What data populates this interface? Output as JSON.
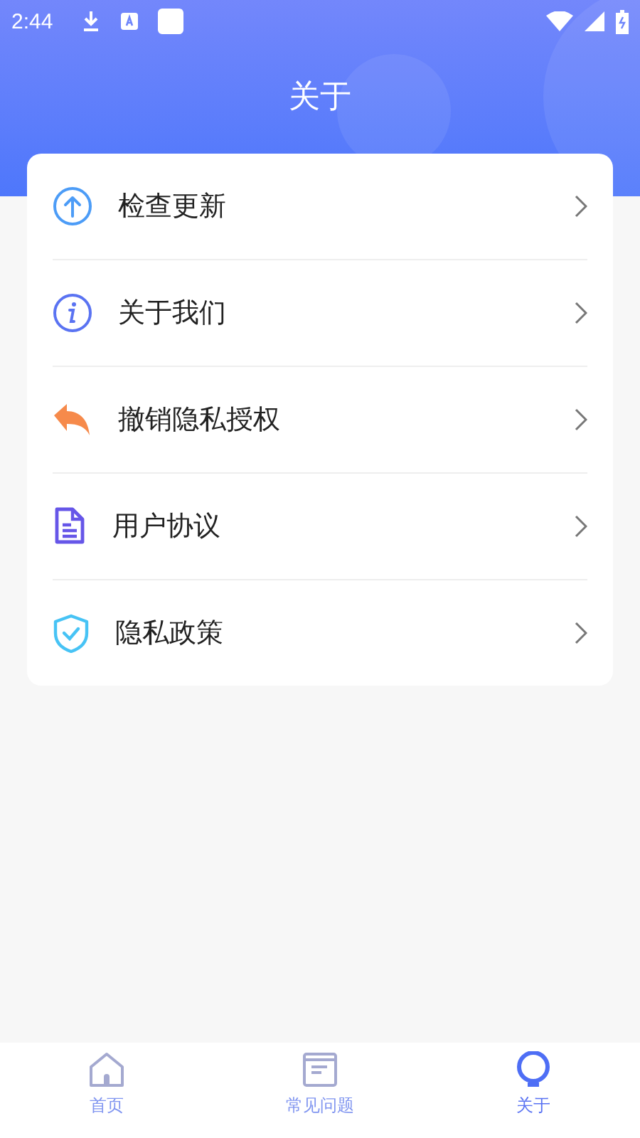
{
  "status_bar": {
    "time": "2:44"
  },
  "header": {
    "title": "关于"
  },
  "menu": [
    {
      "kind": "update",
      "label": "检查更新"
    },
    {
      "kind": "info",
      "label": "关于我们"
    },
    {
      "kind": "revoke",
      "label": "撤销隐私授权"
    },
    {
      "kind": "agreement",
      "label": "用户协议"
    },
    {
      "kind": "privacy",
      "label": "隐私政策"
    }
  ],
  "tabs": [
    {
      "kind": "home",
      "label": "首页",
      "selected": false
    },
    {
      "kind": "faq",
      "label": "常见问题",
      "selected": false
    },
    {
      "kind": "about",
      "label": "关于",
      "selected": true
    }
  ]
}
